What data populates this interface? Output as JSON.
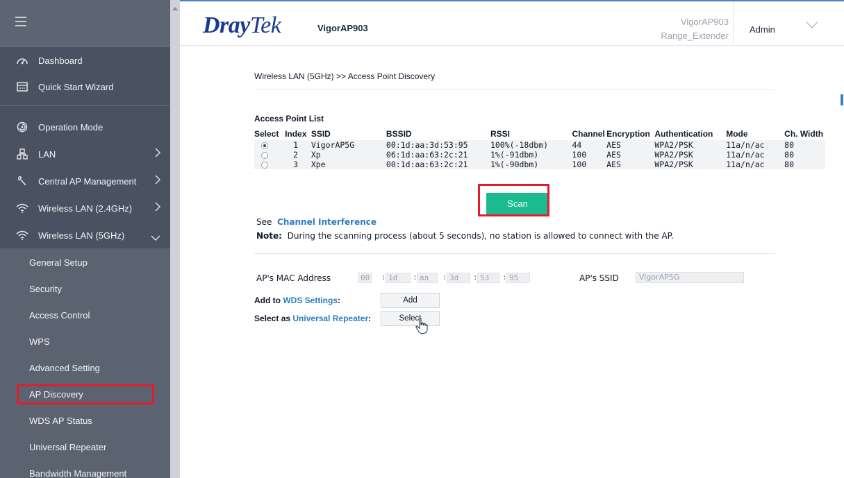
{
  "sidebar": {
    "items": [
      {
        "label": "Dashboard",
        "icon": "dashboard-icon"
      },
      {
        "label": "Quick Start Wizard",
        "icon": "wizard-icon"
      },
      {
        "label": "Operation Mode",
        "icon": "operation-mode-icon"
      },
      {
        "label": "LAN",
        "icon": "lan-icon",
        "chevron": ">"
      },
      {
        "label": "Central AP Management",
        "icon": "wrench-icon",
        "chevron": ">"
      },
      {
        "label": "Wireless LAN (2.4GHz)",
        "icon": "wifi-icon",
        "chevron": ">"
      },
      {
        "label": "Wireless LAN (5GHz)",
        "icon": "wifi-icon",
        "chevron": "v"
      }
    ],
    "submenu": [
      {
        "label": "General Setup"
      },
      {
        "label": "Security"
      },
      {
        "label": "Access Control"
      },
      {
        "label": "WPS"
      },
      {
        "label": "Advanced Setting"
      },
      {
        "label": "AP Discovery",
        "active": true
      },
      {
        "label": "WDS AP Status"
      },
      {
        "label": "Universal Repeater"
      },
      {
        "label": "Bandwidth Management"
      }
    ]
  },
  "header": {
    "logo_dray": "Dray",
    "logo_tek": "Tek",
    "model": "VigorAP903",
    "device_name": "VigorAP903",
    "device_mode": "Range_Extender",
    "user": "Admin"
  },
  "main": {
    "breadcrumb": "Wireless LAN (5GHz) >> Access Point Discovery",
    "ap_list_title": "Access Point List",
    "columns": [
      "Select",
      "Index",
      "SSID",
      "BSSID",
      "RSSI",
      "Channel",
      "Encryption",
      "Authentication",
      "Mode",
      "Ch. Width"
    ],
    "rows": [
      {
        "selected": true,
        "index": "1",
        "ssid": "VigorAP5G",
        "bssid": "00:1d:aa:3d:53:95",
        "rssi": "100%(-18dbm)",
        "channel": "44",
        "encryption": "AES",
        "auth": "WPA2/PSK",
        "mode": "11a/n/ac",
        "width": "80"
      },
      {
        "selected": false,
        "index": "2",
        "ssid": "Xp",
        "bssid": "06:1d:aa:63:2c:21",
        "rssi": "1%(-91dbm)",
        "channel": "100",
        "encryption": "AES",
        "auth": "WPA2/PSK",
        "mode": "11a/n/ac",
        "width": "80"
      },
      {
        "selected": false,
        "index": "3",
        "ssid": "Xpe",
        "bssid": "00:1d:aa:63:2c:21",
        "rssi": "1%(-90dbm)",
        "channel": "100",
        "encryption": "AES",
        "auth": "WPA2/PSK",
        "mode": "11a/n/ac",
        "width": "80"
      }
    ],
    "scan_label": "Scan",
    "see_prefix": "See",
    "see_link": "Channel Interference",
    "note_label": "Note:",
    "note_text": "During the scanning process (about 5 seconds), no station is allowed to connect with the AP.",
    "mac_label": "AP's MAC Address",
    "mac": [
      "00",
      "1d",
      "aa",
      "3d",
      "53",
      "95"
    ],
    "mac_sep": ":",
    "ssid_label": "AP's SSID",
    "ssid_value": "VigorAP5G",
    "wds_prefix": "Add to",
    "wds_link": "WDS Settings",
    "wds_suffix": ":",
    "add_label": "Add",
    "repeater_prefix": "Select as",
    "repeater_link": "Universal Repeater",
    "repeater_suffix": ":",
    "select_label": "Select"
  },
  "colors": {
    "sidebar_bg": "#4a5261",
    "submenu_bg": "#5b6370",
    "accent_scan": "#1bba8f",
    "highlight_red": "#e11d2a",
    "link_blue": "#2e7bbf",
    "logo_blue": "#1a3a8f"
  }
}
